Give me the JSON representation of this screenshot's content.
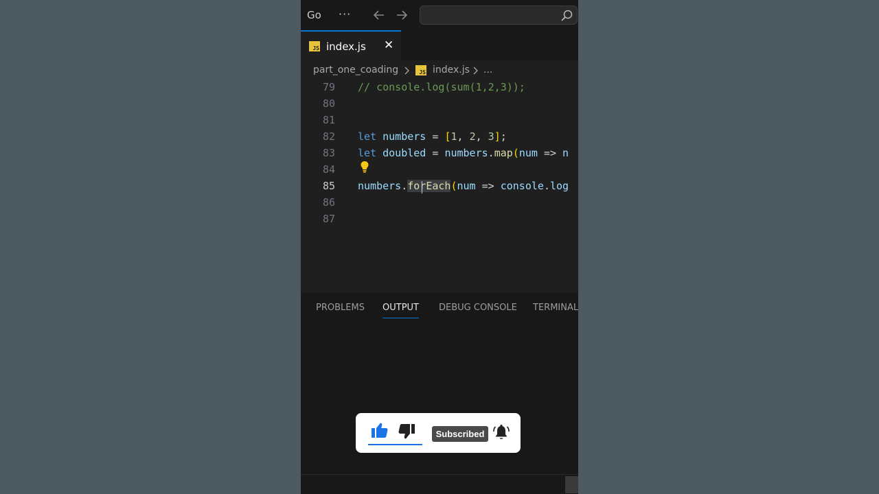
{
  "titlebar": {
    "menu_label": "Go",
    "more_label": "···"
  },
  "tab": {
    "label": "index.js",
    "close": "✕",
    "badge": "JS"
  },
  "breadcrumb": {
    "folder": "part_one_coading",
    "file": "index.js",
    "more": "...",
    "badge": "JS"
  },
  "editor": {
    "active_line": 85,
    "lines": [
      {
        "n": "79",
        "text": "// console.log(sum(1,2,3));"
      },
      {
        "n": "80",
        "text": ""
      },
      {
        "n": "81",
        "text": ""
      },
      {
        "n": "82",
        "text": "let numbers = [1, 2, 3];"
      },
      {
        "n": "83",
        "text": "let doubled = numbers.map(num => n"
      },
      {
        "n": "84",
        "text": ""
      },
      {
        "n": "85",
        "text": "numbers.forEach(num => console.log"
      },
      {
        "n": "86",
        "text": ""
      },
      {
        "n": "87",
        "text": ""
      }
    ]
  },
  "panel": {
    "tabs": [
      "PROBLEMS",
      "OUTPUT",
      "DEBUG CONSOLE",
      "TERMINAL"
    ],
    "active_tab": "OUTPUT"
  },
  "overlay": {
    "subscribe_label": "Subscribed"
  },
  "colors": {
    "accent": "#0078d4",
    "js_badge": "#e8c43a",
    "like_blue": "#1a73e8"
  }
}
